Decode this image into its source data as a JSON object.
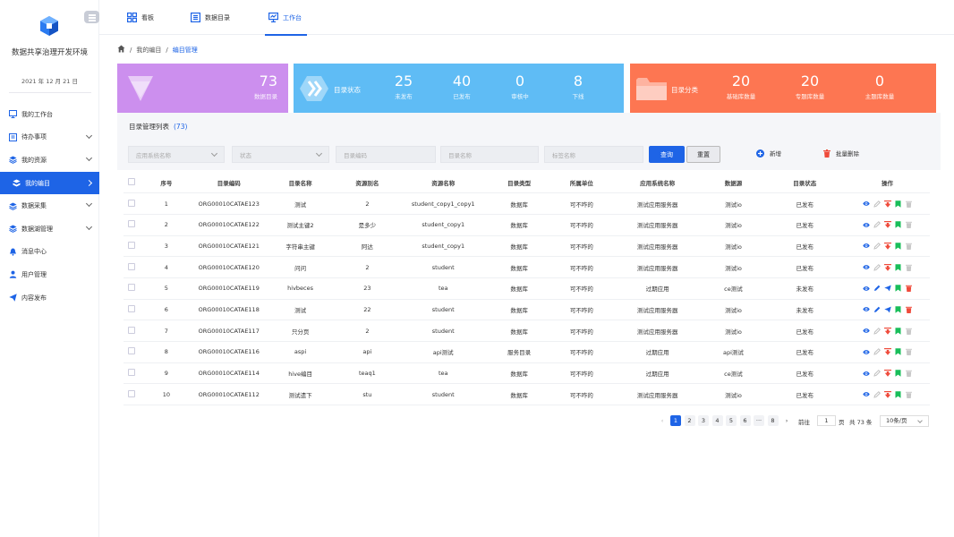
{
  "app": {
    "title": "数据共享治理开发环境",
    "date": "2021 年 12 月 21 日"
  },
  "sidebar": {
    "items": [
      {
        "label": "我的工作台",
        "icon": "monitor-icon",
        "chevron": false,
        "active": false
      },
      {
        "label": "待办事项",
        "icon": "todo-icon",
        "chevron": true,
        "active": false
      },
      {
        "label": "我的资源",
        "icon": "layers-icon",
        "chevron": true,
        "active": false
      },
      {
        "label": "我的编目",
        "icon": "catalog-icon",
        "chevron": true,
        "active": true
      },
      {
        "label": "数据采集",
        "icon": "layers-icon",
        "chevron": true,
        "active": false
      },
      {
        "label": "数据湖管理",
        "icon": "layers-icon",
        "chevron": true,
        "active": false
      },
      {
        "label": "消息中心",
        "icon": "bell-icon",
        "chevron": false,
        "active": false
      },
      {
        "label": "用户管理",
        "icon": "user-icon",
        "chevron": false,
        "active": false
      },
      {
        "label": "内容发布",
        "icon": "send-icon",
        "chevron": false,
        "active": false
      }
    ]
  },
  "tabs": [
    {
      "label": "看板",
      "icon": "dashboard-icon"
    },
    {
      "label": "数据目录",
      "icon": "list-icon"
    },
    {
      "label": "工作台",
      "icon": "workbench-icon"
    }
  ],
  "breadcrumb": {
    "home_icon": "home-icon",
    "items": [
      "我的编目",
      "编目管理"
    ]
  },
  "stats": {
    "total": {
      "value": "73",
      "label": "数据目录"
    },
    "status": {
      "title": "目录状态",
      "items": [
        {
          "value": "25",
          "label": "未发布"
        },
        {
          "value": "40",
          "label": "已发布"
        },
        {
          "value": "0",
          "label": "审核中"
        },
        {
          "value": "8",
          "label": "下线"
        }
      ]
    },
    "category": {
      "title": "目录分类",
      "items": [
        {
          "value": "20",
          "label": "基础库数量"
        },
        {
          "value": "20",
          "label": "专题库数量"
        },
        {
          "value": "0",
          "label": "主题库数量"
        }
      ]
    },
    "colors": {
      "purple": "#cc8fee",
      "blue": "#5fbcf5",
      "orange": "#fd7652",
      "primary": "#1e64e6"
    }
  },
  "list": {
    "title": "目录管理列表",
    "count": "(73)"
  },
  "filters": {
    "app_system": "应用系统名称",
    "status": "状态",
    "catalog_code": "目录编码",
    "catalog_name": "目录名称",
    "tag_name": "标签名称",
    "query": "查询",
    "reset": "重置",
    "add": "新增",
    "batch_delete": "批量删除"
  },
  "table": {
    "headers": [
      "序号",
      "目录编码",
      "目录名称",
      "资源别名",
      "资源名称",
      "目录类型",
      "所属单位",
      "应用系统名称",
      "数据源",
      "目录状态",
      "操作"
    ],
    "rows": [
      [
        "1",
        "ORG00010CATAE123",
        "测试",
        "2",
        "student_copy1_copy1",
        "数据库",
        "可不咋的",
        "测试应用服务器",
        "测试io",
        "已发布"
      ],
      [
        "2",
        "ORG00010CATAE122",
        "测试主键2",
        "是多少",
        "student_copy1",
        "数据库",
        "可不咋的",
        "测试应用服务器",
        "测试io",
        "已发布"
      ],
      [
        "3",
        "ORG00010CATAE121",
        "字符串主键",
        "阿达",
        "student_copy1",
        "数据库",
        "可不咋的",
        "测试应用服务器",
        "测试io",
        "已发布"
      ],
      [
        "4",
        "ORG00010CATAE120",
        "问问",
        "2",
        "student",
        "数据库",
        "可不咋的",
        "测试应用服务器",
        "测试io",
        "已发布"
      ],
      [
        "5",
        "ORG00010CATAE119",
        "hivbeces",
        "23",
        "tea",
        "数据库",
        "可不咋的",
        "过期应用",
        "ce测试",
        "未发布"
      ],
      [
        "6",
        "ORG00010CATAE118",
        "测试",
        "22",
        "student",
        "数据库",
        "可不咋的",
        "测试应用服务器",
        "测试io",
        "未发布"
      ],
      [
        "7",
        "ORG00010CATAE117",
        "只分页",
        "2",
        "student",
        "数据库",
        "可不咋的",
        "测试应用服务器",
        "测试io",
        "已发布"
      ],
      [
        "8",
        "ORG00010CATAE116",
        "aspi",
        "api",
        "api测试",
        "服务目录",
        "可不咋的",
        "过期应用",
        "api测试",
        "已发布"
      ],
      [
        "9",
        "ORG00010CATAE114",
        "hive编目",
        "teaq1",
        "tea",
        "数据库",
        "可不咋的",
        "过期应用",
        "ce测试",
        "已发布"
      ],
      [
        "10",
        "ORG00010CATAE112",
        "测试遗下",
        "stu",
        "student",
        "数据库",
        "可不咋的",
        "测试应用服务器",
        "测试io",
        "已发布"
      ]
    ],
    "row_actions": [
      [
        "view",
        "edit-disabled",
        "offline",
        "bookmark",
        "delete-disabled"
      ],
      [
        "view",
        "edit-disabled",
        "offline",
        "bookmark",
        "delete-disabled"
      ],
      [
        "view",
        "edit-disabled",
        "offline",
        "bookmark",
        "delete-disabled"
      ],
      [
        "view",
        "edit-disabled",
        "offline",
        "bookmark",
        "delete-disabled"
      ],
      [
        "view",
        "edit",
        "publish",
        "bookmark",
        "delete"
      ],
      [
        "view",
        "edit",
        "publish",
        "bookmark",
        "delete"
      ],
      [
        "view",
        "edit-disabled",
        "offline",
        "bookmark",
        "delete-disabled"
      ],
      [
        "view",
        "edit-disabled",
        "offline",
        "bookmark",
        "delete-disabled"
      ],
      [
        "view",
        "edit-disabled",
        "offline",
        "bookmark",
        "delete-disabled"
      ],
      [
        "view",
        "edit-disabled",
        "offline",
        "bookmark",
        "delete-disabled"
      ]
    ]
  },
  "pagination": {
    "pages": [
      "1",
      "2",
      "3",
      "4",
      "5",
      "6",
      "···",
      "8"
    ],
    "current": "1",
    "goto_label": "前往",
    "goto_value": "1",
    "page_unit": "页",
    "total": "共 73 条",
    "page_size": "10条/页"
  }
}
